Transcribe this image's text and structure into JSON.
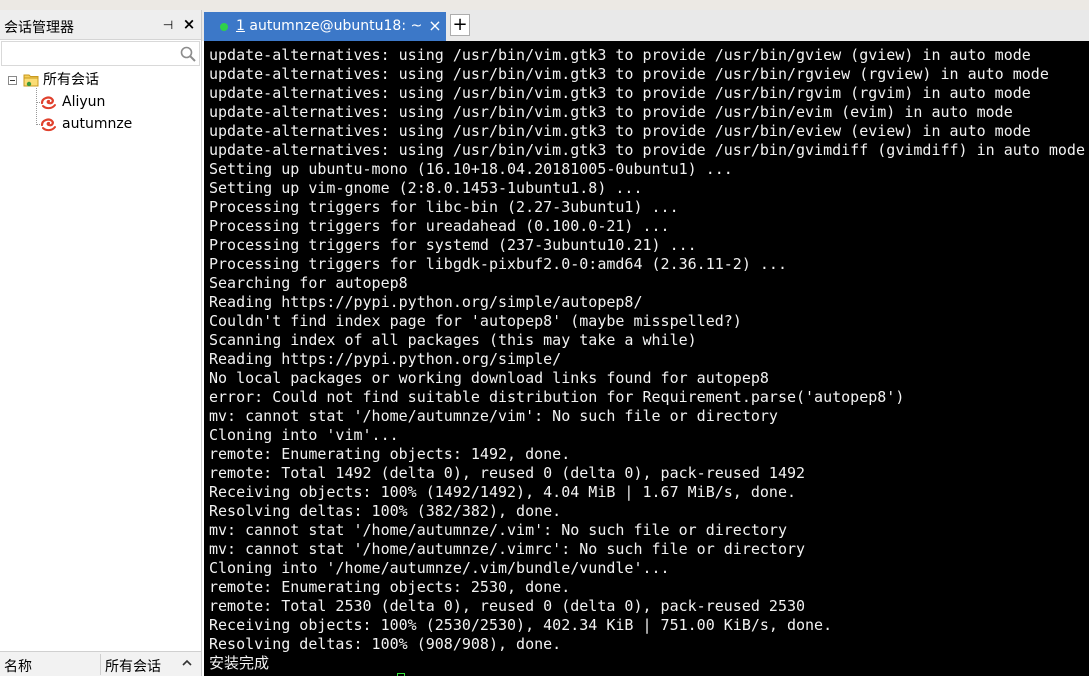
{
  "sidebar": {
    "title": "会话管理器",
    "pin_glyph": "⊣",
    "close_glyph": "×",
    "search": {
      "value": "",
      "placeholder": ""
    },
    "tree": {
      "root_label": "所有会话",
      "items": [
        {
          "label": "Aliyun"
        },
        {
          "label": "autumnze"
        }
      ]
    },
    "footer": {
      "col_name": "名称",
      "col_value": "所有会话"
    }
  },
  "tabs": [
    {
      "number": "1",
      "label": " autumnze@ubuntu18: ~",
      "active": true
    }
  ],
  "tab_close_glyph": "×",
  "tab_add_glyph": "+",
  "terminal": {
    "lines": [
      "update-alternatives: using /usr/bin/vim.gtk3 to provide /usr/bin/gview (gview) in auto mode",
      "update-alternatives: using /usr/bin/vim.gtk3 to provide /usr/bin/rgview (rgview) in auto mode",
      "update-alternatives: using /usr/bin/vim.gtk3 to provide /usr/bin/rgvim (rgvim) in auto mode",
      "update-alternatives: using /usr/bin/vim.gtk3 to provide /usr/bin/evim (evim) in auto mode",
      "update-alternatives: using /usr/bin/vim.gtk3 to provide /usr/bin/eview (eview) in auto mode",
      "update-alternatives: using /usr/bin/vim.gtk3 to provide /usr/bin/gvimdiff (gvimdiff) in auto mode",
      "Setting up ubuntu-mono (16.10+18.04.20181005-0ubuntu1) ...",
      "Setting up vim-gnome (2:8.0.1453-1ubuntu1.8) ...",
      "Processing triggers for libc-bin (2.27-3ubuntu1) ...",
      "Processing triggers for ureadahead (0.100.0-21) ...",
      "Processing triggers for systemd (237-3ubuntu10.21) ...",
      "Processing triggers for libgdk-pixbuf2.0-0:amd64 (2.36.11-2) ...",
      "Searching for autopep8",
      "Reading https://pypi.python.org/simple/autopep8/",
      "Couldn't find index page for 'autopep8' (maybe misspelled?)",
      "Scanning index of all packages (this may take a while)",
      "Reading https://pypi.python.org/simple/",
      "No local packages or working download links found for autopep8",
      "error: Could not find suitable distribution for Requirement.parse('autopep8')",
      "mv: cannot stat '/home/autumnze/vim': No such file or directory",
      "Cloning into 'vim'...",
      "remote: Enumerating objects: 1492, done.",
      "remote: Total 1492 (delta 0), reused 0 (delta 0), pack-reused 1492",
      "Receiving objects: 100% (1492/1492), 4.04 MiB | 1.67 MiB/s, done.",
      "Resolving deltas: 100% (382/382), done.",
      "mv: cannot stat '/home/autumnze/.vim': No such file or directory",
      "mv: cannot stat '/home/autumnze/.vimrc': No such file or directory",
      "Cloning into '/home/autumnze/.vim/bundle/vundle'...",
      "remote: Enumerating objects: 2530, done.",
      "remote: Total 2530 (delta 0), reused 0 (delta 0), pack-reused 2530",
      "Receiving objects: 100% (2530/2530), 402.34 KiB | 751.00 KiB/s, done.",
      "Resolving deltas: 100% (908/908), done.",
      "安装完成"
    ]
  },
  "colors": {
    "tab_active": "#3c78c8",
    "tab_status_dot": "#2fd14a",
    "terminal_bg": "#000000",
    "terminal_fg": "#f2f2f2",
    "cursor": "#35e03a",
    "session_icon": "#e0412d"
  },
  "icons": {
    "search": "search-icon",
    "folder": "folder-icon",
    "session": "session-swirl-icon",
    "sort": "sort-asc-icon"
  }
}
